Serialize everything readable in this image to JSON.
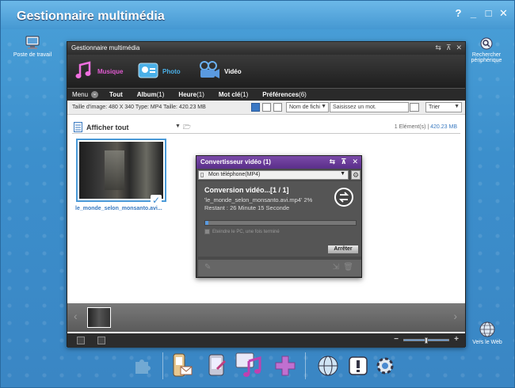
{
  "app": {
    "title": "Gestionnaire multimédia"
  },
  "window_controls": {
    "help": "?",
    "minimize": "_",
    "maximize": "□",
    "close": "✕"
  },
  "side": {
    "workstation_label": "Poste de travail",
    "search_device_label": "Rechercher périphérique",
    "web_label": "Vers le Web"
  },
  "inner": {
    "title": "Gestionnaire multimédia",
    "media_tabs": [
      {
        "label": "Musique",
        "color": "#e05ad0"
      },
      {
        "label": "Photo",
        "color": "#4ab0e8"
      },
      {
        "label": "Vidéo",
        "color": "#ffffff"
      }
    ],
    "nav": {
      "menu": "Menu",
      "all": "Tout",
      "album": "Album",
      "album_count": "(1)",
      "hour": "Heure",
      "hour_count": "(1)",
      "keyword": "Mot clé",
      "keyword_count": "(1)",
      "prefs": "Préférences",
      "prefs_count": "(6)"
    },
    "info": {
      "details": "Taille d'image: 480 X 340 Type: MP4 Taille: 420.23 MB",
      "sort_field": "Nom de fichi",
      "search_placeholder": "Saisissez un mot.",
      "sort_label": "Trier"
    },
    "content": {
      "show_all": "Afficher tout",
      "count": "1 Elément(s)",
      "size": "420.23 MB",
      "file_name": "le_monde_selon_monsanto.avi..."
    }
  },
  "converter": {
    "title": "Convertisseur vidéo",
    "title_count": "(1)",
    "device": "Mon téléphone(MP4)",
    "heading": "Conversion vidéo...[1 / 1]",
    "file_line": "'le_monde_selon_monsanto.avi.mp4' 2%",
    "remaining": "Restant : 26 Minute 15 Seconde",
    "progress": 0.02,
    "shutdown": "Eteindre le PC, une fois terminé",
    "stop": "Arrêter"
  },
  "colors": {
    "desktop_blue": "#3c8fcc",
    "accent_purple": "#6a3a9a",
    "selection_blue": "#4a9ad8"
  }
}
